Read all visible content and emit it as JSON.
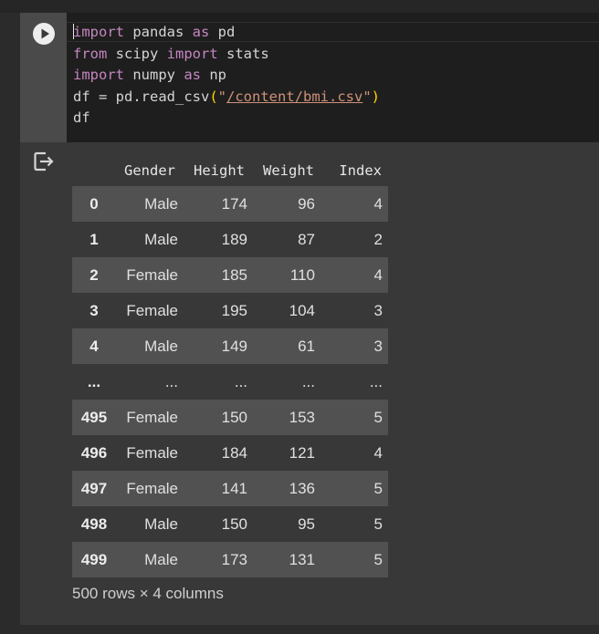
{
  "code_cell": {
    "lines": [
      {
        "tokens": [
          {
            "t": "import",
            "k": "kw"
          },
          {
            "t": " pandas ",
            "k": "plain"
          },
          {
            "t": "as",
            "k": "kw"
          },
          {
            "t": " pd",
            "k": "plain"
          }
        ]
      },
      {
        "tokens": [
          {
            "t": "from",
            "k": "kw"
          },
          {
            "t": " scipy ",
            "k": "plain"
          },
          {
            "t": "import",
            "k": "kw"
          },
          {
            "t": " stats",
            "k": "plain"
          }
        ]
      },
      {
        "tokens": [
          {
            "t": "import",
            "k": "kw"
          },
          {
            "t": " numpy ",
            "k": "plain"
          },
          {
            "t": "as",
            "k": "kw"
          },
          {
            "t": " np",
            "k": "plain"
          }
        ]
      },
      {
        "tokens": [
          {
            "t": "df = pd.read_csv",
            "k": "plain"
          },
          {
            "t": "(",
            "k": "paren"
          },
          {
            "t": "\"",
            "k": "str"
          },
          {
            "t": "/content/bmi.csv",
            "k": "str-link"
          },
          {
            "t": "\"",
            "k": "str"
          },
          {
            "t": ")",
            "k": "paren"
          }
        ]
      },
      {
        "tokens": [
          {
            "t": "df",
            "k": "plain"
          }
        ]
      }
    ]
  },
  "icons": {
    "run": "play-circle-icon",
    "output": "output-exit-icon"
  },
  "table": {
    "columns": [
      "Gender",
      "Height",
      "Weight",
      "Index"
    ],
    "rows": [
      {
        "index": "0",
        "cells": [
          "Male",
          "174",
          "96",
          "4"
        ]
      },
      {
        "index": "1",
        "cells": [
          "Male",
          "189",
          "87",
          "2"
        ]
      },
      {
        "index": "2",
        "cells": [
          "Female",
          "185",
          "110",
          "4"
        ]
      },
      {
        "index": "3",
        "cells": [
          "Female",
          "195",
          "104",
          "3"
        ]
      },
      {
        "index": "4",
        "cells": [
          "Male",
          "149",
          "61",
          "3"
        ]
      },
      {
        "index": "...",
        "cells": [
          "...",
          "...",
          "...",
          "..."
        ]
      },
      {
        "index": "495",
        "cells": [
          "Female",
          "150",
          "153",
          "5"
        ]
      },
      {
        "index": "496",
        "cells": [
          "Female",
          "184",
          "121",
          "4"
        ]
      },
      {
        "index": "497",
        "cells": [
          "Female",
          "141",
          "136",
          "5"
        ]
      },
      {
        "index": "498",
        "cells": [
          "Male",
          "150",
          "95",
          "5"
        ]
      },
      {
        "index": "499",
        "cells": [
          "Male",
          "173",
          "131",
          "5"
        ]
      }
    ],
    "summary": "500 rows × 4 columns"
  },
  "colors": {
    "page_bg": "#2b2b2b",
    "cell_bg": "#383838",
    "editor_bg": "#1e1e1e",
    "keyword": "#c586c0",
    "string": "#ce9178",
    "paren": "#ffd700",
    "row_stripe": "#515151"
  }
}
